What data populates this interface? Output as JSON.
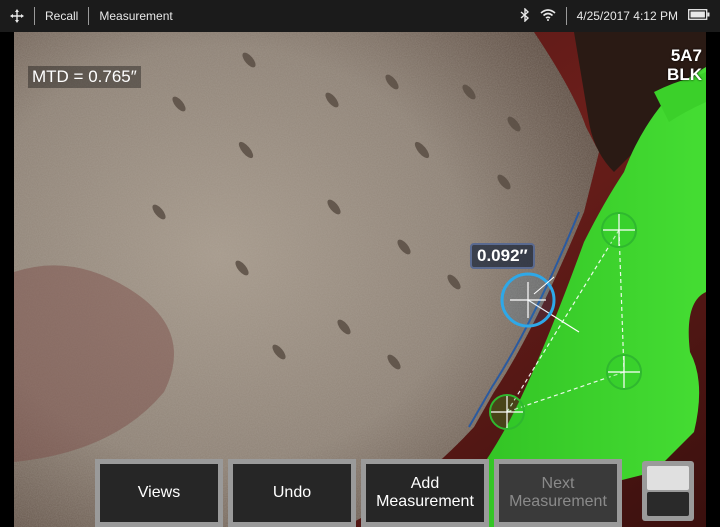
{
  "status_bar": {
    "nav_icon": "move-cross-icon",
    "recall_label": "Recall",
    "measurement_label": "Measurement",
    "bluetooth_icon": "bluetooth-icon",
    "wifi_icon": "wifi-icon",
    "datetime": "4/25/2017 4:12 PM",
    "battery_icon": "battery-icon"
  },
  "viewer": {
    "mtd_text": "MTD = 0.765″",
    "probe_line1": "5A7",
    "probe_line2": "BLK",
    "depth_value": "0.092″",
    "colors": {
      "overlay_green": "#33cc22",
      "cursor_blue": "#2ea8e8",
      "cursor_green": "#2fb82f"
    }
  },
  "softkeys": {
    "views": "Views",
    "undo": "Undo",
    "add_line1": "Add",
    "add_line2": "Measurement",
    "next_line1": "Next",
    "next_line2": "Measurement"
  }
}
